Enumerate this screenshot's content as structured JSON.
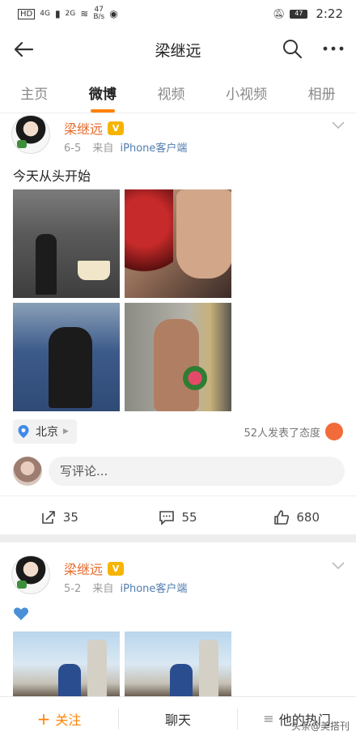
{
  "status": {
    "network_left": "4G",
    "network_right": "2G",
    "speed_value": "47",
    "speed_unit": "B/s",
    "battery": "47",
    "time": "2:22"
  },
  "header": {
    "title": "梁继远"
  },
  "tabs": [
    {
      "label": "主页"
    },
    {
      "label": "微博"
    },
    {
      "label": "视频"
    },
    {
      "label": "小视频"
    },
    {
      "label": "相册"
    }
  ],
  "post1": {
    "author": "梁继远",
    "date": "6-5",
    "from": "来自",
    "source": "iPhone客户端",
    "text": "今天从头开始",
    "location": "北京",
    "reactions": "52人发表了态度",
    "comment_placeholder": "写评论...",
    "repost_count": "35",
    "comment_count": "55",
    "like_count": "680"
  },
  "post2": {
    "author": "梁继远",
    "date": "5-2",
    "from": "来自",
    "source": "iPhone客户端",
    "text_emoji": "💙"
  },
  "bottom": {
    "follow": "关注",
    "chat": "聊天",
    "hot": "他的热门"
  },
  "watermark": "头条@美搭刊",
  "colors": {
    "accent": "#ff8200",
    "author": "#e86b2b",
    "source": "#507daf"
  }
}
